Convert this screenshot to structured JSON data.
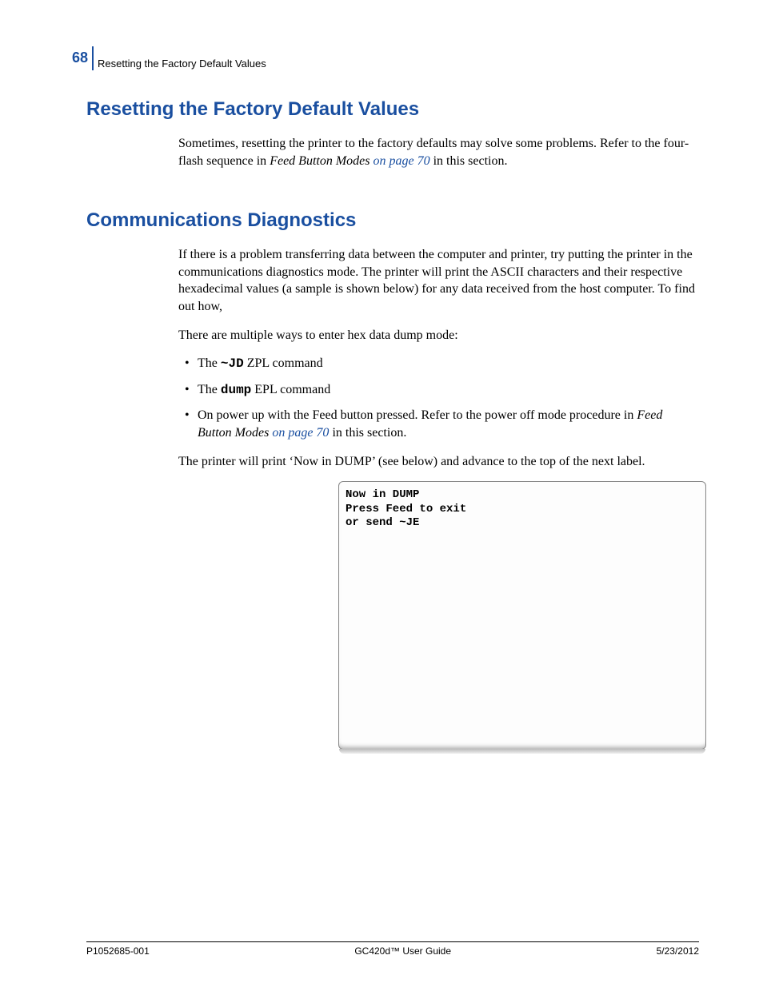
{
  "page_number": "68",
  "header_title": "Resetting the Factory Default Values",
  "section1": {
    "heading": "Resetting the Factory Default Values",
    "para_a": "Sometimes, resetting the printer to the factory defaults may solve some problems. Refer to the four-flash sequence in ",
    "link_italic_pre": "Feed Button Modes",
    "link_text": " on page 70",
    "para_b": " in this section."
  },
  "section2": {
    "heading": "Communications Diagnostics",
    "para1": "If there is a problem transferring data between the computer and printer, try putting the printer in the communications diagnostics mode. The printer will print the ASCII characters and their respective hexadecimal values (a sample is shown below) for any data received from the host computer. To find out how,",
    "para2": "There are multiple ways to enter hex data dump mode:",
    "bullet1_a": "The ",
    "bullet1_code": "~JD",
    "bullet1_b": " ZPL command",
    "bullet2_a": "The ",
    "bullet2_code": "dump",
    "bullet2_b": " EPL command",
    "bullet3_a": "On power up with the Feed button pressed. Refer to the power off mode procedure in ",
    "bullet3_italic": "Feed Button Modes",
    "bullet3_link": " on page 70",
    "bullet3_b": " in this section.",
    "para3": "The printer will print ‘Now in DUMP’ (see below) and advance to the top of the next label."
  },
  "label_box": {
    "line1": "Now in DUMP",
    "line2": "Press Feed to exit",
    "line3": "or send ~JE"
  },
  "footer": {
    "left": "P1052685-001",
    "center": "GC420d™ User Guide",
    "right": "5/23/2012"
  }
}
